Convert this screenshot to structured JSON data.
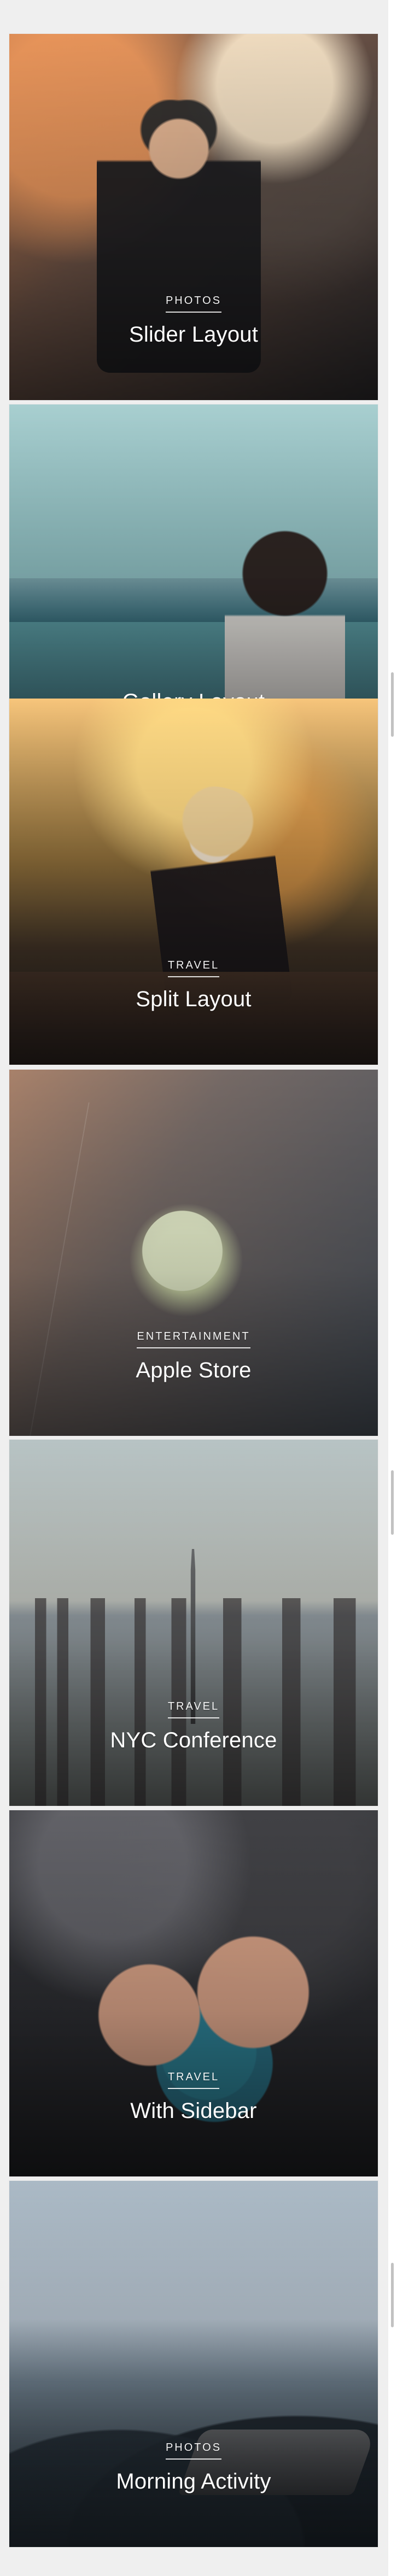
{
  "feed": {
    "cards": [
      {
        "category": "PHOTOS",
        "title": "Slider Layout"
      },
      {
        "category": "",
        "title": "Gallery Layout"
      },
      {
        "category": "TRAVEL",
        "title": "Split Layout"
      },
      {
        "category": "ENTERTAINMENT",
        "title": "Apple Store"
      },
      {
        "category": "TRAVEL",
        "title": "NYC Conference"
      },
      {
        "category": "TRAVEL",
        "title": "With Sidebar"
      },
      {
        "category": "PHOTOS",
        "title": "Morning Activity"
      }
    ]
  }
}
